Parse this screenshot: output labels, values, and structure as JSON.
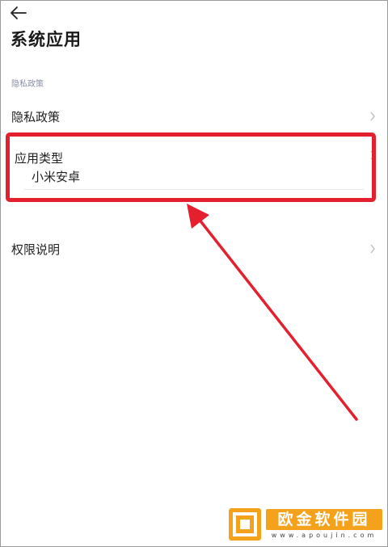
{
  "header": {
    "title": "系统应用"
  },
  "section": {
    "label": "隐私政策"
  },
  "rows": [
    {
      "label": "隐私政策"
    },
    {
      "label": "应用类型",
      "value": "小米安卓"
    },
    {
      "label": "权限说明"
    }
  ],
  "watermark": {
    "name": "欧金软件园",
    "url": "www.apoujin.com"
  },
  "colors": {
    "annotation": "#e5202e",
    "watermark": "#f4a11c"
  },
  "icons": [
    "back-arrow-icon",
    "chevron-right-icon",
    "annotation-arrow",
    "watermark-logo-icon"
  ]
}
